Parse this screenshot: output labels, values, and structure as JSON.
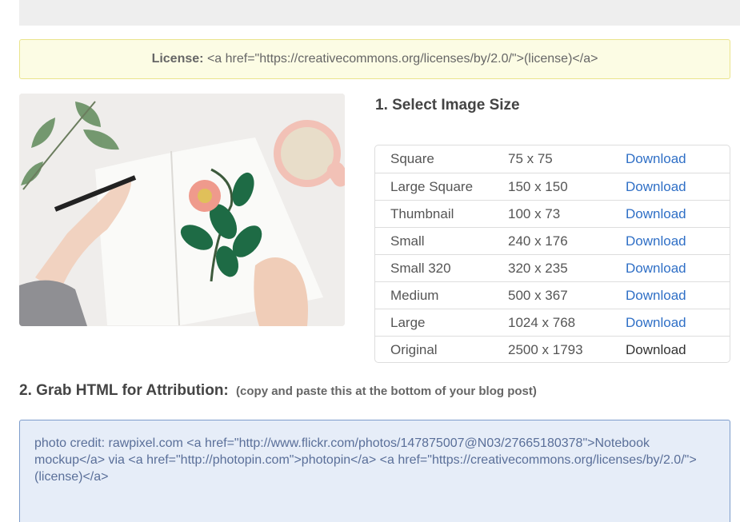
{
  "license": {
    "label": "License:",
    "code": "<a href=\"https://creativecommons.org/licenses/by/2.0/\">(license)</a>"
  },
  "select_size": {
    "heading": "1. Select Image Size",
    "rows": [
      {
        "name": "Square",
        "dims": "75 x 75",
        "action": "Download"
      },
      {
        "name": "Large Square",
        "dims": "150 x 150",
        "action": "Download"
      },
      {
        "name": "Thumbnail",
        "dims": "100 x 73",
        "action": "Download"
      },
      {
        "name": "Small",
        "dims": "240 x 176",
        "action": "Download"
      },
      {
        "name": "Small 320",
        "dims": "320 x 235",
        "action": "Download"
      },
      {
        "name": "Medium",
        "dims": "500 x 367",
        "action": "Download"
      },
      {
        "name": "Large",
        "dims": "1024 x 768",
        "action": "Download"
      },
      {
        "name": "Original",
        "dims": "2500 x 1793",
        "action": "Download"
      }
    ]
  },
  "attribution": {
    "heading": "2. Grab HTML for Attribution:",
    "subheading": "(copy and paste this at the bottom of your blog post)",
    "code": "photo credit: rawpixel.com <a href=\"http://www.flickr.com/photos/147875007@N03/27665180378\">Notebook mockup</a> via <a href=\"http://photopin.com\">photopin</a> <a href=\"https://creativecommons.org/licenses/by/2.0/\">(license)</a>"
  },
  "colors": {
    "link": "#2f6fc6",
    "license_bg": "#fcfce4",
    "credit_bg": "#e6edf8"
  }
}
